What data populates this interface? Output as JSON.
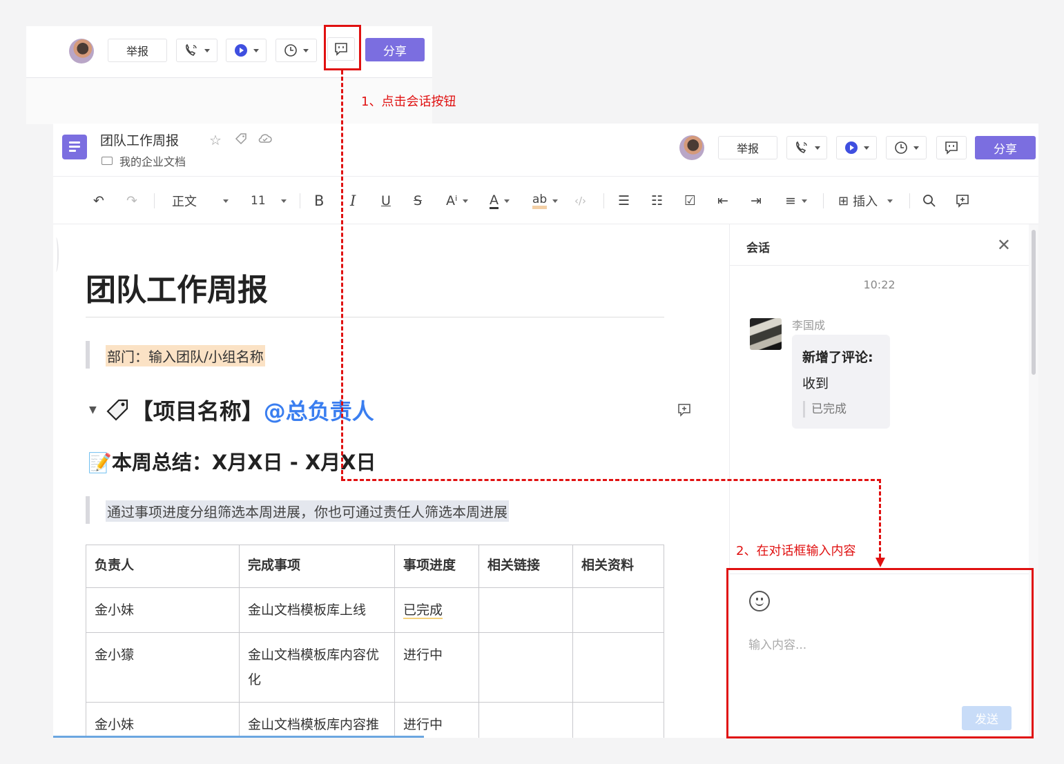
{
  "header": {
    "report_label": "举报",
    "share_label": "分享"
  },
  "document": {
    "title": "团队工作周报",
    "path": "我的企业文档",
    "heading": "团队工作周报",
    "department": "部门：输入团队/小组名称",
    "project_prefix": "【项目名称】",
    "project_mention": "@总负责人",
    "summary_heading": "本周总结：X月X日 - X月X日",
    "tip": "通过事项进度分组筛选本周进展，你也可通过责任人筛选本周进展"
  },
  "toolbar": {
    "style_label": "正文",
    "font_size": "11",
    "insert_label": "插入"
  },
  "table": {
    "headers": [
      "负责人",
      "完成事项",
      "事项进度",
      "相关链接",
      "相关资料"
    ],
    "rows": [
      [
        "金小妹",
        "金山文档模板库上线",
        "已完成",
        "",
        ""
      ],
      [
        "金小獴",
        "金山文档模板库内容优化",
        "进行中",
        "",
        ""
      ],
      [
        "金小妹",
        "金山文档模板库内容推广",
        "进行中",
        "",
        ""
      ]
    ]
  },
  "chat": {
    "title": "会话",
    "time": "10:22",
    "user": "李国成",
    "message_title": "新增了评论:",
    "message_body": "收到",
    "message_quote": "已完成",
    "input_placeholder": "输入内容...",
    "send_label": "发送"
  },
  "annotations": {
    "step1": "1、点击会话按钮",
    "step2": "2、在对话框输入内容"
  },
  "colors": {
    "accent": "#7b6ee0",
    "annotation": "#e01010",
    "mention": "#3a7ef0"
  }
}
